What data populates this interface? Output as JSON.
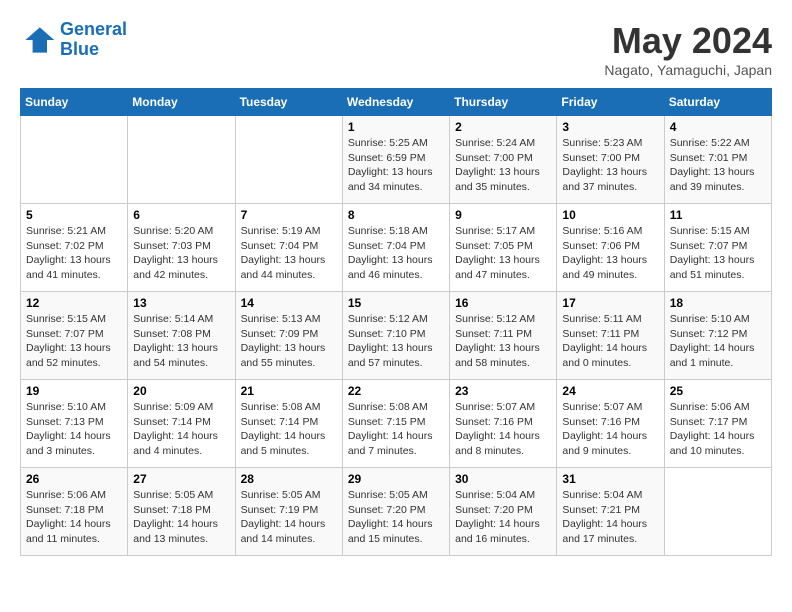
{
  "logo": {
    "line1": "General",
    "line2": "Blue"
  },
  "title": "May 2024",
  "location": "Nagato, Yamaguchi, Japan",
  "weekdays": [
    "Sunday",
    "Monday",
    "Tuesday",
    "Wednesday",
    "Thursday",
    "Friday",
    "Saturday"
  ],
  "weeks": [
    [
      {
        "day": "",
        "sunrise": "",
        "sunset": "",
        "daylight": ""
      },
      {
        "day": "",
        "sunrise": "",
        "sunset": "",
        "daylight": ""
      },
      {
        "day": "",
        "sunrise": "",
        "sunset": "",
        "daylight": ""
      },
      {
        "day": "1",
        "sunrise": "Sunrise: 5:25 AM",
        "sunset": "Sunset: 6:59 PM",
        "daylight": "Daylight: 13 hours and 34 minutes."
      },
      {
        "day": "2",
        "sunrise": "Sunrise: 5:24 AM",
        "sunset": "Sunset: 7:00 PM",
        "daylight": "Daylight: 13 hours and 35 minutes."
      },
      {
        "day": "3",
        "sunrise": "Sunrise: 5:23 AM",
        "sunset": "Sunset: 7:00 PM",
        "daylight": "Daylight: 13 hours and 37 minutes."
      },
      {
        "day": "4",
        "sunrise": "Sunrise: 5:22 AM",
        "sunset": "Sunset: 7:01 PM",
        "daylight": "Daylight: 13 hours and 39 minutes."
      }
    ],
    [
      {
        "day": "5",
        "sunrise": "Sunrise: 5:21 AM",
        "sunset": "Sunset: 7:02 PM",
        "daylight": "Daylight: 13 hours and 41 minutes."
      },
      {
        "day": "6",
        "sunrise": "Sunrise: 5:20 AM",
        "sunset": "Sunset: 7:03 PM",
        "daylight": "Daylight: 13 hours and 42 minutes."
      },
      {
        "day": "7",
        "sunrise": "Sunrise: 5:19 AM",
        "sunset": "Sunset: 7:04 PM",
        "daylight": "Daylight: 13 hours and 44 minutes."
      },
      {
        "day": "8",
        "sunrise": "Sunrise: 5:18 AM",
        "sunset": "Sunset: 7:04 PM",
        "daylight": "Daylight: 13 hours and 46 minutes."
      },
      {
        "day": "9",
        "sunrise": "Sunrise: 5:17 AM",
        "sunset": "Sunset: 7:05 PM",
        "daylight": "Daylight: 13 hours and 47 minutes."
      },
      {
        "day": "10",
        "sunrise": "Sunrise: 5:16 AM",
        "sunset": "Sunset: 7:06 PM",
        "daylight": "Daylight: 13 hours and 49 minutes."
      },
      {
        "day": "11",
        "sunrise": "Sunrise: 5:15 AM",
        "sunset": "Sunset: 7:07 PM",
        "daylight": "Daylight: 13 hours and 51 minutes."
      }
    ],
    [
      {
        "day": "12",
        "sunrise": "Sunrise: 5:15 AM",
        "sunset": "Sunset: 7:07 PM",
        "daylight": "Daylight: 13 hours and 52 minutes."
      },
      {
        "day": "13",
        "sunrise": "Sunrise: 5:14 AM",
        "sunset": "Sunset: 7:08 PM",
        "daylight": "Daylight: 13 hours and 54 minutes."
      },
      {
        "day": "14",
        "sunrise": "Sunrise: 5:13 AM",
        "sunset": "Sunset: 7:09 PM",
        "daylight": "Daylight: 13 hours and 55 minutes."
      },
      {
        "day": "15",
        "sunrise": "Sunrise: 5:12 AM",
        "sunset": "Sunset: 7:10 PM",
        "daylight": "Daylight: 13 hours and 57 minutes."
      },
      {
        "day": "16",
        "sunrise": "Sunrise: 5:12 AM",
        "sunset": "Sunset: 7:11 PM",
        "daylight": "Daylight: 13 hours and 58 minutes."
      },
      {
        "day": "17",
        "sunrise": "Sunrise: 5:11 AM",
        "sunset": "Sunset: 7:11 PM",
        "daylight": "Daylight: 14 hours and 0 minutes."
      },
      {
        "day": "18",
        "sunrise": "Sunrise: 5:10 AM",
        "sunset": "Sunset: 7:12 PM",
        "daylight": "Daylight: 14 hours and 1 minute."
      }
    ],
    [
      {
        "day": "19",
        "sunrise": "Sunrise: 5:10 AM",
        "sunset": "Sunset: 7:13 PM",
        "daylight": "Daylight: 14 hours and 3 minutes."
      },
      {
        "day": "20",
        "sunrise": "Sunrise: 5:09 AM",
        "sunset": "Sunset: 7:14 PM",
        "daylight": "Daylight: 14 hours and 4 minutes."
      },
      {
        "day": "21",
        "sunrise": "Sunrise: 5:08 AM",
        "sunset": "Sunset: 7:14 PM",
        "daylight": "Daylight: 14 hours and 5 minutes."
      },
      {
        "day": "22",
        "sunrise": "Sunrise: 5:08 AM",
        "sunset": "Sunset: 7:15 PM",
        "daylight": "Daylight: 14 hours and 7 minutes."
      },
      {
        "day": "23",
        "sunrise": "Sunrise: 5:07 AM",
        "sunset": "Sunset: 7:16 PM",
        "daylight": "Daylight: 14 hours and 8 minutes."
      },
      {
        "day": "24",
        "sunrise": "Sunrise: 5:07 AM",
        "sunset": "Sunset: 7:16 PM",
        "daylight": "Daylight: 14 hours and 9 minutes."
      },
      {
        "day": "25",
        "sunrise": "Sunrise: 5:06 AM",
        "sunset": "Sunset: 7:17 PM",
        "daylight": "Daylight: 14 hours and 10 minutes."
      }
    ],
    [
      {
        "day": "26",
        "sunrise": "Sunrise: 5:06 AM",
        "sunset": "Sunset: 7:18 PM",
        "daylight": "Daylight: 14 hours and 11 minutes."
      },
      {
        "day": "27",
        "sunrise": "Sunrise: 5:05 AM",
        "sunset": "Sunset: 7:18 PM",
        "daylight": "Daylight: 14 hours and 13 minutes."
      },
      {
        "day": "28",
        "sunrise": "Sunrise: 5:05 AM",
        "sunset": "Sunset: 7:19 PM",
        "daylight": "Daylight: 14 hours and 14 minutes."
      },
      {
        "day": "29",
        "sunrise": "Sunrise: 5:05 AM",
        "sunset": "Sunset: 7:20 PM",
        "daylight": "Daylight: 14 hours and 15 minutes."
      },
      {
        "day": "30",
        "sunrise": "Sunrise: 5:04 AM",
        "sunset": "Sunset: 7:20 PM",
        "daylight": "Daylight: 14 hours and 16 minutes."
      },
      {
        "day": "31",
        "sunrise": "Sunrise: 5:04 AM",
        "sunset": "Sunset: 7:21 PM",
        "daylight": "Daylight: 14 hours and 17 minutes."
      },
      {
        "day": "",
        "sunrise": "",
        "sunset": "",
        "daylight": ""
      }
    ]
  ]
}
